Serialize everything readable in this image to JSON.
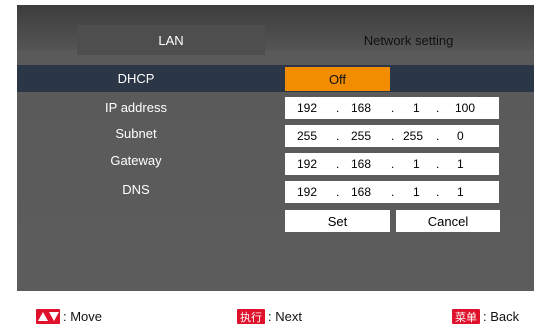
{
  "header": {
    "lan_tab": "LAN",
    "network_setting_tab": "Network setting"
  },
  "dhcp": {
    "label": "DHCP",
    "value": "Off"
  },
  "fields": {
    "ip": {
      "label": "IP address",
      "octets": [
        "192",
        "168",
        "1",
        "100"
      ]
    },
    "subnet": {
      "label": "Subnet",
      "octets": [
        "255",
        "255",
        "255",
        "0"
      ]
    },
    "gateway": {
      "label": "Gateway",
      "octets": [
        "192",
        "168",
        "1",
        "1"
      ]
    },
    "dns": {
      "label": "DNS",
      "octets": [
        "192",
        "168",
        "1",
        "1"
      ]
    }
  },
  "separator": ".",
  "buttons": {
    "set": "Set",
    "cancel": "Cancel"
  },
  "footer": {
    "move_label": ": Move",
    "next_key": "执行",
    "next_label": ": Next",
    "back_key": "菜单",
    "back_label": ": Back"
  },
  "colors": {
    "accent": "#f28c00",
    "footer_key": "#e0112a",
    "panel": "#5a5a5a",
    "highlight_row": "#2b3646"
  },
  "icons": {
    "move": "up-down-arrows-icon"
  }
}
